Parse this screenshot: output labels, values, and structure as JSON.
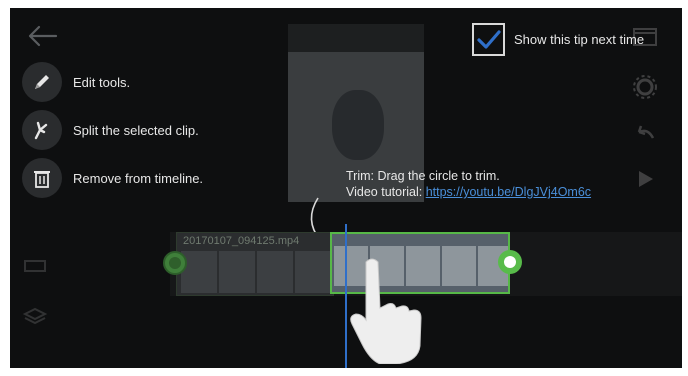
{
  "tips": [
    {
      "icon": "pencil-icon",
      "label": "Edit tools."
    },
    {
      "icon": "split-icon",
      "label": "Split the selected clip."
    },
    {
      "icon": "trash-icon",
      "label": "Remove from timeline."
    }
  ],
  "show_tip": {
    "label": "Show this tip next time",
    "checked": true
  },
  "trim": {
    "line1": "Trim: Drag the circle to trim.",
    "tutorial_prefix": "Video tutorial: ",
    "link": "https://youtu.be/DlgJVj4Om6c"
  },
  "timeline": {
    "clip_name": "20170107_094125.mp4"
  },
  "colors": {
    "accent": "#57b848",
    "link": "#4a8fd9",
    "playhead": "#2f6fc9",
    "checkbox_mark": "#2f6fc9"
  }
}
